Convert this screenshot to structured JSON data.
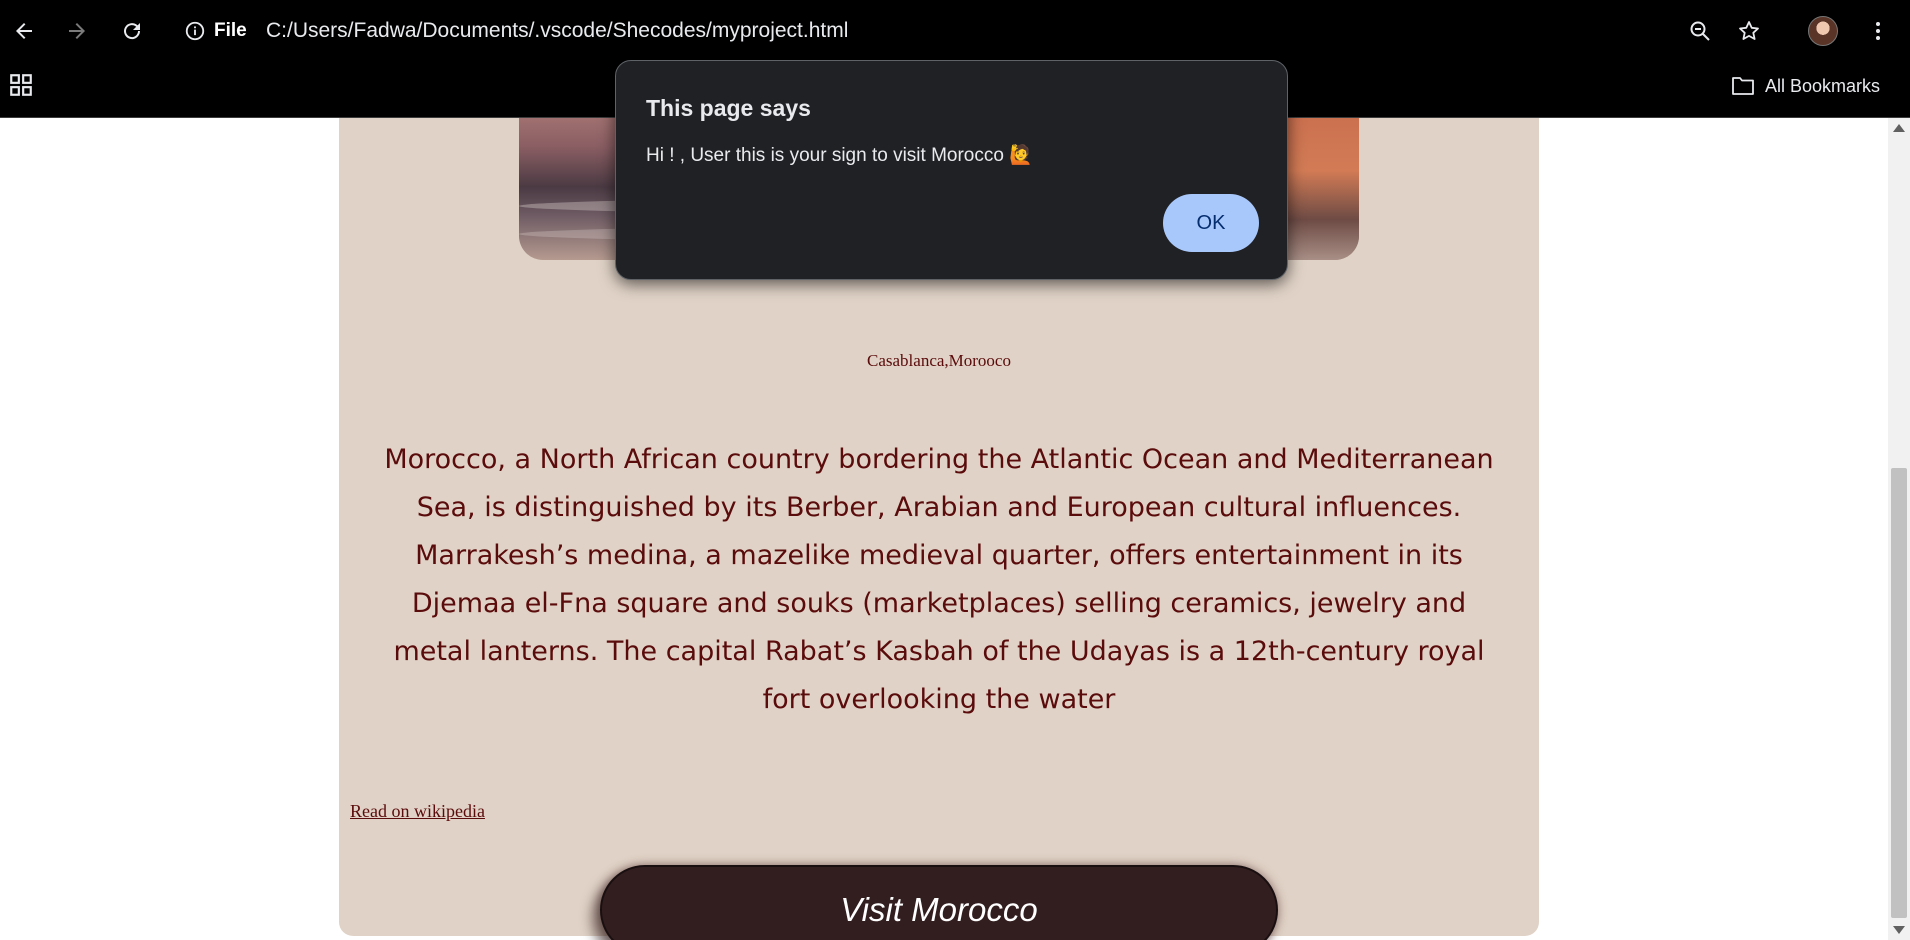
{
  "browser": {
    "site_info_label": "File",
    "url": "C:/Users/Fadwa/Documents/.vscode/Shecodes/myproject.html",
    "bookmarks_label": "All Bookmarks"
  },
  "page": {
    "caption": "Casablanca,Morooco",
    "description": "Morocco, a North African country bordering the Atlantic Ocean and Mediterranean Sea, is distinguished by its Berber, Arabian and European cultural influences. Marrakesh’s medina, a mazelike medieval quarter, offers entertainment in its Djemaa el-Fna square and souks (marketplaces) selling ceramics, jewelry and metal lanterns. The capital Rabat’s Kasbah of the Udayas is a 12th-century royal fort overlooking the water",
    "wiki_link": "Read on wikipedia",
    "visit_button": "Visit Morocco"
  },
  "dialog": {
    "title": "This page says",
    "message": "Hi ! , User this is your sign to visit Morocco 🙋",
    "ok_label": "OK"
  },
  "colors": {
    "card_bg": "#e0d2c6",
    "text": "#5a0b0b",
    "button_bg": "#331e1f",
    "dialog_bg": "#202124",
    "ok_bg": "#a8c7fa"
  }
}
